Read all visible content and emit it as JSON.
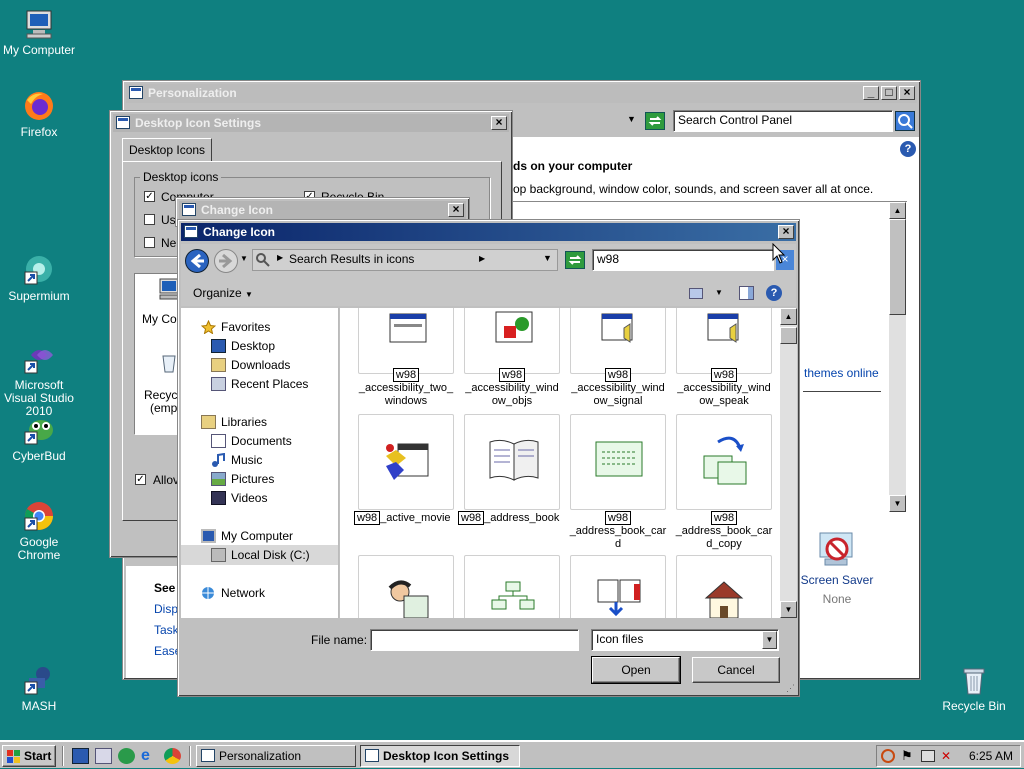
{
  "desktop_icons": [
    {
      "label": "My Computer",
      "icon": "computer-icon"
    },
    {
      "label": "Firefox",
      "icon": "firefox-icon"
    },
    {
      "label": "Supermium",
      "icon": "supermium-icon"
    },
    {
      "label": "Microsoft Visual Studio 2010",
      "icon": "visual-studio-icon"
    },
    {
      "label": "CyberBud",
      "icon": "cyberbud-icon"
    },
    {
      "label": "Google Chrome",
      "icon": "chrome-icon"
    },
    {
      "label": "MASH",
      "icon": "mash-icon"
    },
    {
      "label": "Recycle Bin",
      "icon": "recycle-bin-icon"
    }
  ],
  "personalization": {
    "title": "Personalization",
    "search_placeholder": "Search Control Panel",
    "heading": "ds on your computer",
    "subtitle": "op background, window color, sounds, and screen saver all at once.",
    "themes_link": "themes online",
    "screen_saver_label": "Screen Saver",
    "screen_saver_value": "None",
    "see_also": "See",
    "see_links": [
      "Displ",
      "Task",
      "Ease"
    ]
  },
  "desktop_icon_settings": {
    "title": "Desktop Icon Settings",
    "tab": "Desktop Icons",
    "group_label": "Desktop icons",
    "check_computer": "Computer",
    "check_recycle": "Recycle Bin",
    "check_user": "Us",
    "check_network": "Ne",
    "preview_items": [
      "My Co",
      "Recyc",
      "(emp"
    ],
    "allow_label": "Allov"
  },
  "change_icon_back": {
    "title": "Change Icon"
  },
  "change_icon": {
    "title": "Change Icon",
    "breadcrumb": "Search Results in icons",
    "search_value": "w98",
    "organize": "Organize",
    "nav": {
      "favorites": "Favorites",
      "desktop": "Desktop",
      "downloads": "Downloads",
      "recent": "Recent Places",
      "libraries": "Libraries",
      "documents": "Documents",
      "music": "Music",
      "pictures": "Pictures",
      "videos": "Videos",
      "my_computer": "My Computer",
      "local_disk": "Local Disk (C:)",
      "network": "Network"
    },
    "files": [
      {
        "prefix": "w98",
        "rest": "_accessibility_two_windows",
        "l2": "_accessibility_two_",
        "l3": "windows",
        "icon": "window-icon"
      },
      {
        "prefix": "w98",
        "rest": "_accessibility_window_objs",
        "l2": "_accessibility_wind",
        "l3": "ow_objs",
        "icon": "shapes-icon"
      },
      {
        "prefix": "w98",
        "rest": "_accessibility_window_signal",
        "l2": "_accessibility_wind",
        "l3": "ow_signal",
        "icon": "window-sound-icon"
      },
      {
        "prefix": "w98",
        "rest": "_accessibility_window_speak",
        "l2": "_accessibility_wind",
        "l3": "ow_speak",
        "icon": "window-speak-icon"
      },
      {
        "prefix": "w98",
        "rest": "_active_movie",
        "icon": "movie-icon"
      },
      {
        "prefix": "w98",
        "rest": "_address_book",
        "icon": "book-icon"
      },
      {
        "prefix": "w98",
        "rest": "_address_book_card",
        "l2": "_address_book_car",
        "l3": "d",
        "icon": "card-icon"
      },
      {
        "prefix": "w98",
        "rest": "_address_book_card_copy",
        "l2": "_address_book_car",
        "l3": "d_copy",
        "icon": "card-copy-icon"
      }
    ],
    "file_name_label": "File name:",
    "file_name_value": "",
    "file_type": "Icon files",
    "open": "Open",
    "cancel": "Cancel"
  },
  "taskbar": {
    "start": "Start",
    "tasks": [
      "Personalization",
      "Desktop Icon Settings"
    ],
    "clock": "6:25 AM"
  }
}
